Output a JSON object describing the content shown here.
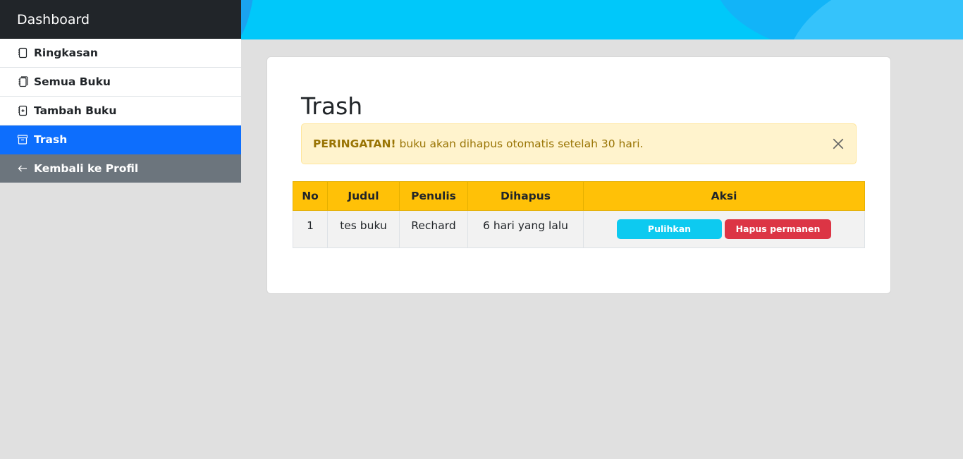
{
  "sidebar": {
    "brand": "Dashboard",
    "items": [
      {
        "label": "Ringkasan",
        "icon": "journal-icon"
      },
      {
        "label": "Semua Buku",
        "icon": "journals-icon"
      },
      {
        "label": "Tambah Buku",
        "icon": "journal-plus-icon"
      },
      {
        "label": "Trash",
        "icon": "archive-icon",
        "active": true
      },
      {
        "label": "Kembali ke Profil",
        "icon": "arrow-left-icon"
      }
    ]
  },
  "main": {
    "title": "Trash",
    "alert": {
      "strong": "PERINGATAN!",
      "text": "buku akan dihapus otomatis setelah 30 hari."
    },
    "table": {
      "headers": [
        "No",
        "Judul",
        "Penulis",
        "Dihapus",
        "Aksi"
      ],
      "rows": [
        {
          "no": "1",
          "judul": "tes buku",
          "penulis": "Rechard",
          "dihapus": "6 hari yang lalu",
          "restore_label": "Pulihkan",
          "delete_label": "Hapus permanen"
        }
      ]
    }
  },
  "colors": {
    "sidebar_dark": "#212529",
    "active": "#0d6efd",
    "back": "#6c757d",
    "topbar": "#00c8fa",
    "table_header": "#ffc107",
    "info": "#0dcaf0",
    "danger": "#dc3545"
  }
}
